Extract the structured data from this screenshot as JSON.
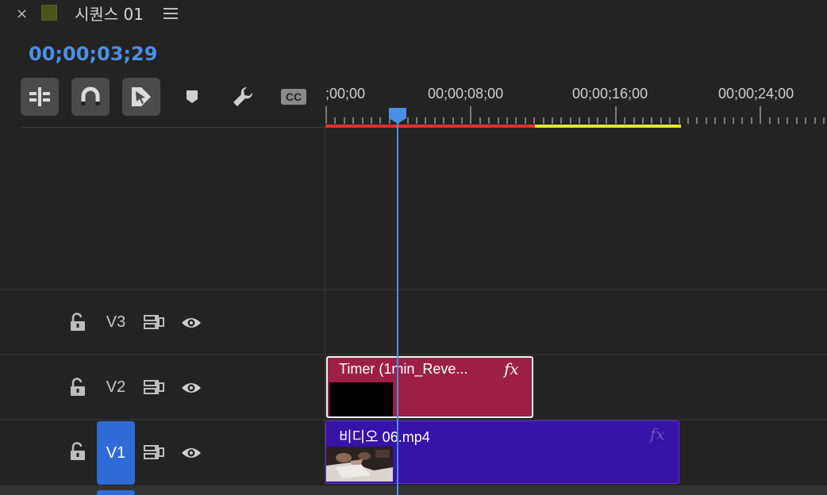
{
  "header": {
    "close_label": "×",
    "sequence_title": "시퀀스 01",
    "sequence_color": "#4a5318"
  },
  "timecode": "00;00;03;29",
  "toolbar": {
    "items": [
      "insert-nest-icon",
      "snap-magnet-icon",
      "linked-selection-icon",
      "add-marker-icon",
      "settings-wrench-icon",
      "captions-icon"
    ],
    "captions_label": "CC"
  },
  "ruler": {
    "labels": [
      ";00;00",
      "00;00;08;00",
      "00;00;16;00",
      "00;00;24;00"
    ],
    "render_colors": {
      "rendered": "#e8302a",
      "unrendered": "#e6e62b"
    }
  },
  "tracks": [
    {
      "name": "V3",
      "active": false
    },
    {
      "name": "V2",
      "active": false
    },
    {
      "name": "V1",
      "active": true
    }
  ],
  "clips": {
    "timer": {
      "label": "Timer (1min_Reve...",
      "fx": "fx",
      "color": "#9c2046"
    },
    "video": {
      "label": "비디오 06.mp4",
      "fx": "fx",
      "color": "#3713a8"
    }
  },
  "colors": {
    "accent": "#4c8fe6",
    "track_active": "#2f6bd6"
  }
}
